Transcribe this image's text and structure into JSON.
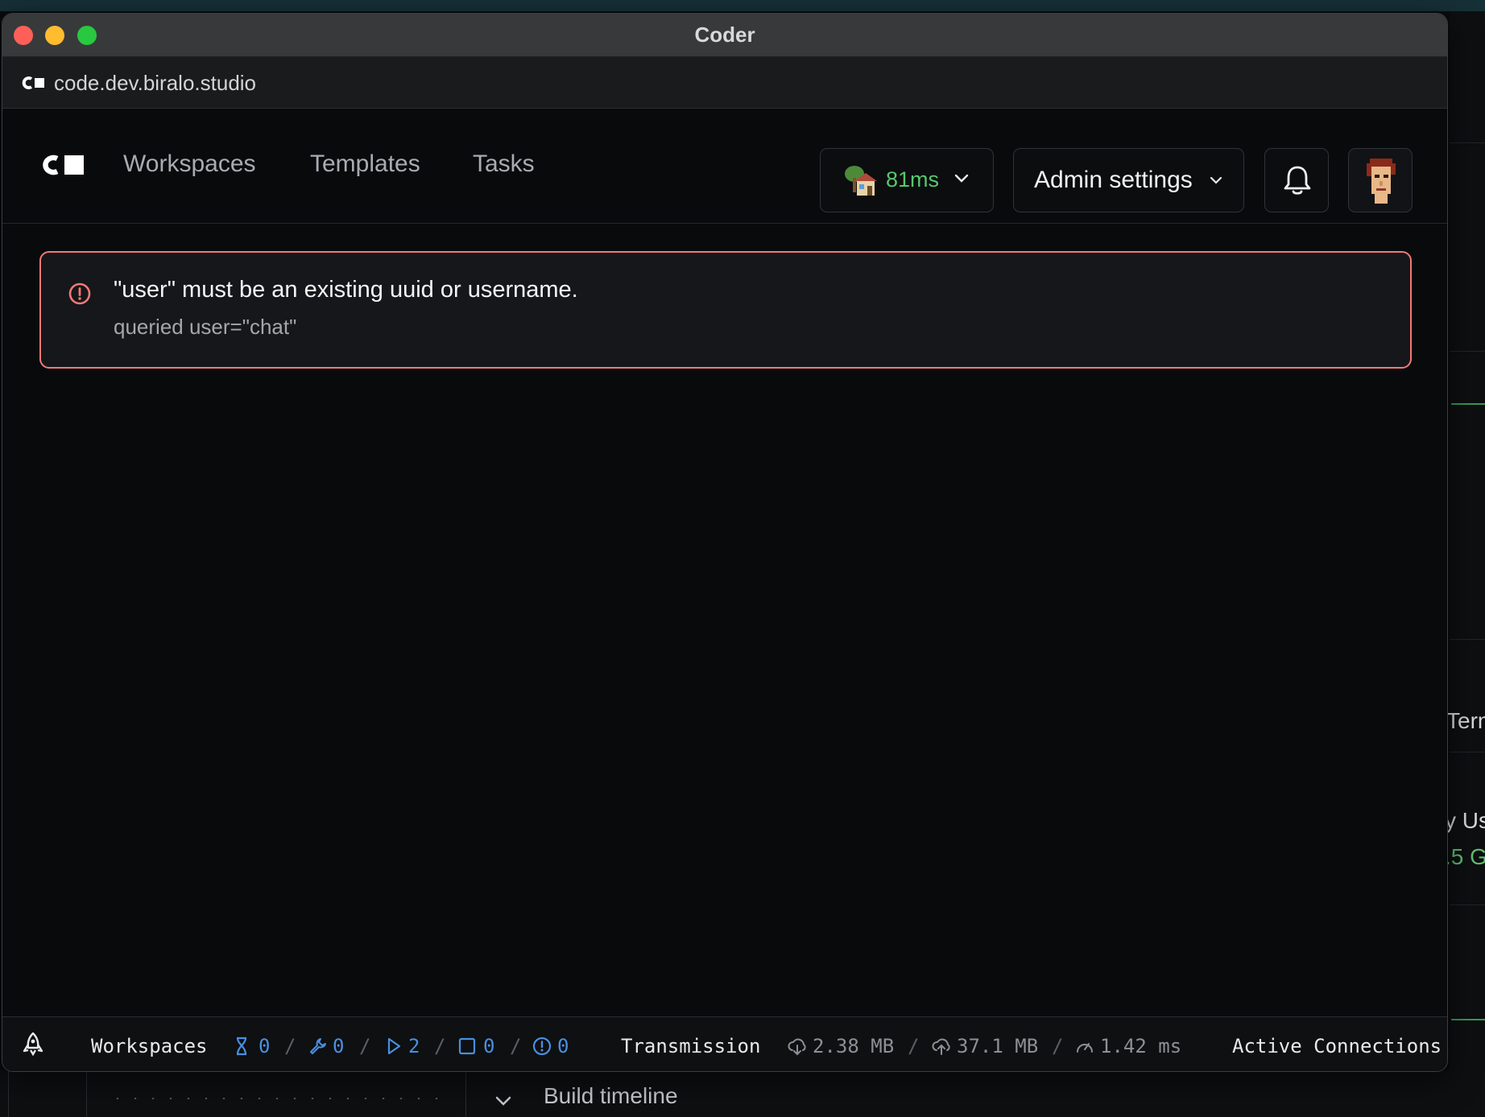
{
  "window": {
    "title": "Coder"
  },
  "urlbar": {
    "url": "code.dev.biralo.studio"
  },
  "nav": {
    "links": [
      {
        "label": "Workspaces"
      },
      {
        "label": "Templates"
      },
      {
        "label": "Tasks"
      }
    ],
    "latency": "81ms",
    "admin_settings": "Admin settings"
  },
  "alert": {
    "title": "\"user\" must be an existing uuid or username.",
    "detail": "queried user=\"chat\""
  },
  "statusbar": {
    "workspaces_label": "Workspaces",
    "pending": "0",
    "building": "0",
    "running": "2",
    "stopped": "0",
    "failed": "0",
    "transmission_label": "Transmission",
    "download": "2.38 MB",
    "upload": "37.1 MB",
    "latency": "1.42 ms",
    "connections_label": "Active Connections"
  },
  "background": {
    "right_text_1": "Term",
    "right_text_2": "y Us",
    "right_text_3": ".5 G",
    "bottom_label": "Build timeline"
  },
  "colors": {
    "accent_green": "#58c76d",
    "error_border": "#f07b78",
    "status_blue": "#4a8fe0"
  }
}
